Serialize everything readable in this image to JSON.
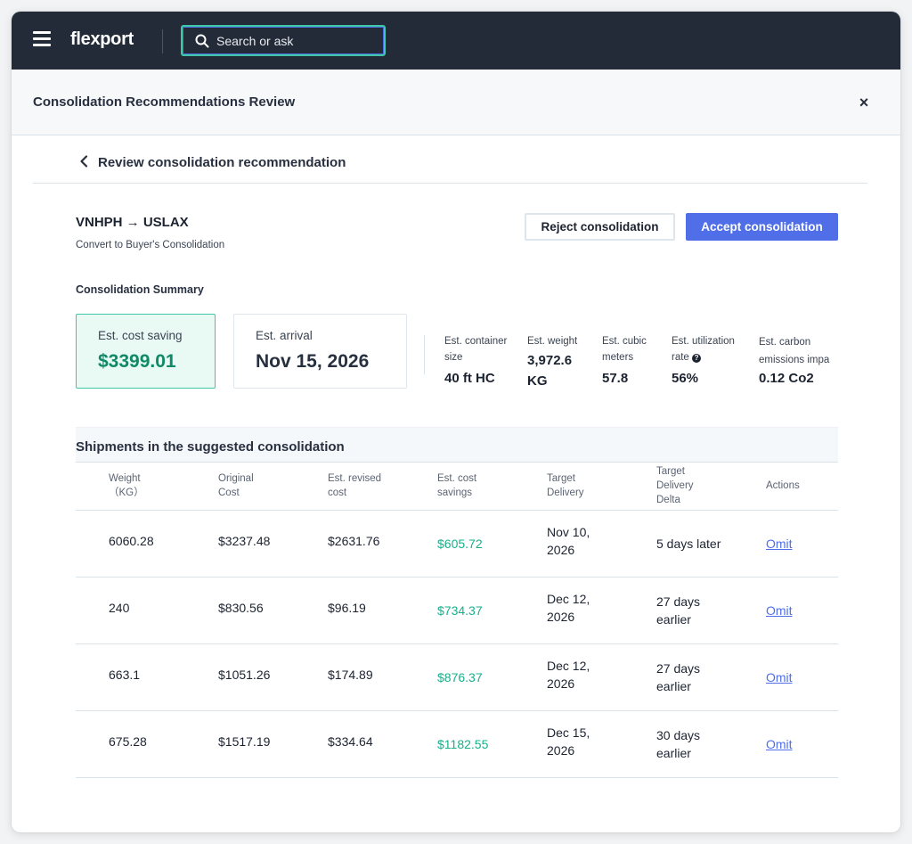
{
  "topbar": {
    "logo": "flexport",
    "search_placeholder": "Search or ask"
  },
  "modal": {
    "title": "Consolidation Recommendations Review",
    "close_glyph": "×"
  },
  "back": {
    "label": "Review consolidation recommendation"
  },
  "route": {
    "title": "VNHPH → USLAX",
    "subtitle": "Convert to Buyer's Consolidation"
  },
  "actions": {
    "reject": "Reject consolidation",
    "accept": "Accept consolidation"
  },
  "summary": {
    "heading": "Consolidation Summary",
    "cost_saving": {
      "label": "Est. cost saving",
      "value": "$3399.01"
    },
    "arrival": {
      "label": "Est. arrival",
      "value": "Nov 15, 2026"
    },
    "stats": [
      {
        "label": "Est. container size",
        "value": "40 ft HC"
      },
      {
        "label": "Est. weight",
        "value": "3,972.6 KG"
      },
      {
        "label": "Est. cubic meters",
        "value": "57.8"
      },
      {
        "label": "Est. utilization rate",
        "value": "56%"
      },
      {
        "label": "Est. carbon emissions impa",
        "value": "0.12 Co2"
      }
    ]
  },
  "table": {
    "title": "Shipments in the suggested consolidation",
    "headers": {
      "weight": "Weight\n（KG）",
      "original": "Original\nCost",
      "revised": "Est. revised\ncost",
      "savings": "Est. cost\nsavings",
      "delivery": "Target\nDelivery",
      "delta": "Target\nDelivery\nDelta",
      "actions": "Actions"
    },
    "rows": [
      {
        "weight": "6060.28",
        "original": "$3237.48",
        "revised": "$2631.76",
        "savings": "$605.72",
        "delivery": "Nov 10,\n2026",
        "delta": "5 days later",
        "action": "Omit"
      },
      {
        "weight": "240",
        "original": "$830.56",
        "revised": "$96.19",
        "savings": "$734.37",
        "delivery": "Dec 12,\n2026",
        "delta": "27 days\nearlier",
        "action": "Omit"
      },
      {
        "weight": "663.1",
        "original": "$1051.26",
        "revised": "$174.89",
        "savings": "$876.37",
        "delivery": "Dec 12,\n2026",
        "delta": "27 days\nearlier",
        "action": "Omit"
      },
      {
        "weight": "675.28",
        "original": "$1517.19",
        "revised": "$334.64",
        "savings": "$1182.55",
        "delivery": "Dec 15,\n2026",
        "delta": "30 days\nearlier",
        "action": "Omit"
      }
    ]
  },
  "colors": {
    "topbar": "#232b38",
    "accent_blue": "#4f6ee8",
    "accent_green": "#3ec8a8",
    "saving_green": "#0f8a66"
  }
}
